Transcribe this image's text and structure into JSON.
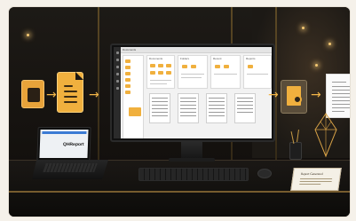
{
  "monitor": {
    "app_title": "Documents",
    "panes": [
      "Documents",
      "Folders",
      "Recent",
      "Reports"
    ]
  },
  "laptop": {
    "screen_text": "QHReport"
  },
  "certificate": {
    "title": "Report Generated"
  },
  "icons": {
    "left_doc": "document-icon",
    "big_doc": "file-text-icon",
    "gear_doc": "document-settings-icon",
    "final_doc": "report-document-icon",
    "arrow": "arrow-right-icon"
  },
  "arrows": [
    "→",
    "→",
    "→",
    "→",
    "→"
  ],
  "colors": {
    "accent": "#f0b03e",
    "background": "#141210"
  }
}
